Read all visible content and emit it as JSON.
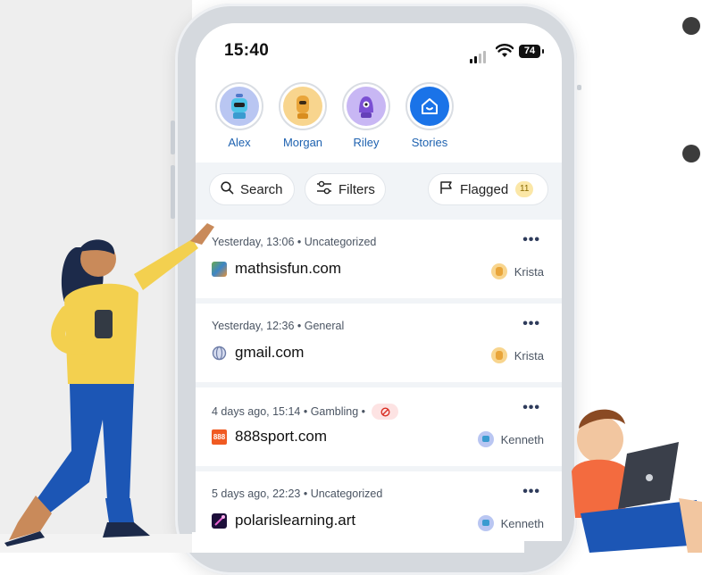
{
  "status_bar": {
    "time": "15:40",
    "battery": "74"
  },
  "profiles": [
    {
      "name": "Alex",
      "color": "#b9c6f2",
      "icon": "robot-avatar-icon"
    },
    {
      "name": "Morgan",
      "color": "#f8d58e",
      "icon": "robot-avatar-icon"
    },
    {
      "name": "Riley",
      "color": "#c8b7f4",
      "icon": "robot-avatar-icon"
    },
    {
      "name": "Stories",
      "color": "#1a73e8",
      "icon": "home-icon"
    }
  ],
  "toolbar": {
    "search_label": "Search",
    "filters_label": "Filters",
    "flagged_label": "Flagged",
    "flagged_count": "11"
  },
  "activity": [
    {
      "meta": "Yesterday, 13:06 • Uncategorized",
      "domain": "mathsisfun.com",
      "user": "Krista",
      "favicon": "mathsisfun-favicon-icon"
    },
    {
      "meta": "Yesterday, 12:36 • General",
      "domain": "gmail.com",
      "user": "Krista",
      "favicon": "globe-icon"
    },
    {
      "meta": "4 days ago, 15:14 • Gambling •",
      "domain": "888sport.com",
      "user": "Kenneth",
      "favicon": "888sport-favicon-icon",
      "blocked": true
    },
    {
      "meta": "5 days ago, 22:23 • Uncategorized",
      "domain": "polarislearning.art",
      "user": "Kenneth",
      "favicon": "polarislearning-favicon-icon"
    }
  ],
  "colors": {
    "accent": "#1a73e8",
    "profile_name": "#1e62b0",
    "flag_badge": "#fbe7a7",
    "blocked_badge": "#fde3e3",
    "page_bg": "#f1f4f7"
  }
}
